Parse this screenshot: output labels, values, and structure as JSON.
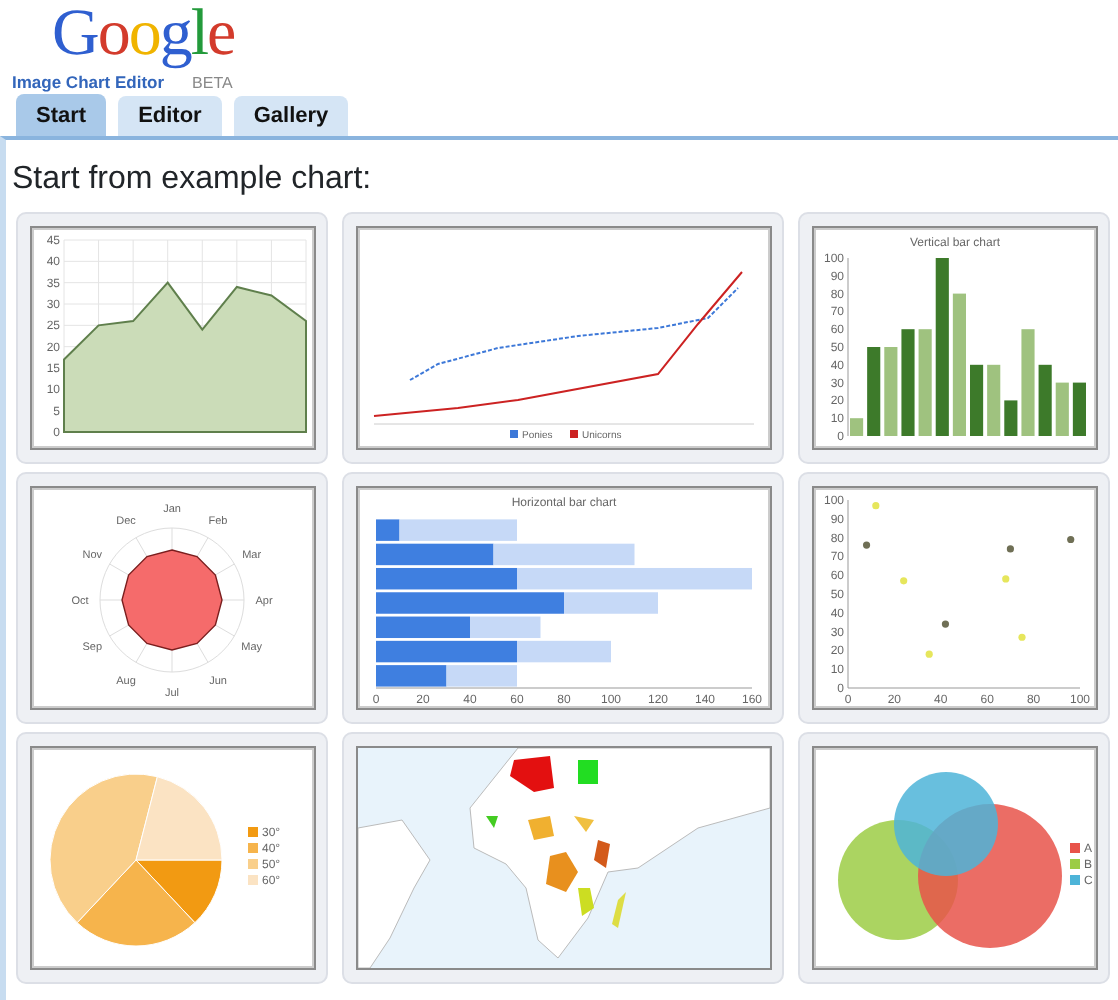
{
  "logo": {
    "wordmark": "Google",
    "product": "Image Chart Editor",
    "badge": "BETA"
  },
  "tabs": [
    {
      "label": "Start",
      "selected": true
    },
    {
      "label": "Editor",
      "selected": false
    },
    {
      "label": "Gallery",
      "selected": false
    }
  ],
  "heading": "Start from example chart:",
  "examples": [
    {
      "chart_data": {
        "type": "area",
        "grid": true,
        "ylim": [
          0,
          45
        ],
        "yticks": [
          0,
          5,
          10,
          15,
          20,
          25,
          30,
          35,
          40,
          45
        ],
        "series": [
          {
            "color": "#5f7f4c",
            "values": [
              17,
              25,
              26,
              35,
              24,
              34,
              32,
              26
            ]
          }
        ]
      }
    },
    {
      "kind": "line",
      "legend": [
        {
          "label": "Ponies",
          "color": "#3d78d8"
        },
        {
          "label": "Unicorns",
          "color": "#cc2222"
        }
      ]
    },
    {
      "chart_data": {
        "type": "bar",
        "title": "Vertical bar chart",
        "categories": [
          null,
          null,
          null,
          null,
          null,
          null,
          null,
          null,
          null,
          null,
          null,
          null,
          null,
          null
        ],
        "ylim": [
          0,
          100
        ],
        "yticks": [
          0,
          10,
          20,
          30,
          40,
          50,
          60,
          70,
          80,
          90,
          100
        ],
        "series": [
          {
            "colors": [
              "#9fc27f",
              "#3d7a2a",
              "#9fc27f",
              "#3d7a2a",
              "#9fc27f",
              "#3d7a2a",
              "#9fc27f",
              "#3d7a2a",
              "#9fc27f",
              "#3d7a2a",
              "#9fc27f",
              "#3d7a2a",
              "#9fc27f",
              "#3d7a2a"
            ],
            "values": [
              10,
              50,
              50,
              60,
              60,
              100,
              80,
              40,
              40,
              20,
              60,
              40,
              30,
              30
            ]
          }
        ]
      }
    },
    {
      "kind": "radar",
      "labels": [
        "Jan",
        "Feb",
        "Mar",
        "Apr",
        "May",
        "Jun",
        "Jul",
        "Aug",
        "Sep",
        "Oct",
        "Nov",
        "Dec"
      ]
    },
    {
      "chart_data": {
        "type": "bar",
        "orientation": "horizontal",
        "stacked": true,
        "title": "Horizontal bar chart",
        "categories": [
          null,
          null,
          null,
          null,
          null,
          null,
          null
        ],
        "xlim": [
          0,
          160
        ],
        "xticks": [
          0,
          20,
          40,
          60,
          80,
          100,
          120,
          140,
          160
        ],
        "series": [
          {
            "color": "#3f7fe0",
            "values": [
              10,
              50,
              60,
              80,
              40,
              60,
              30
            ]
          },
          {
            "color": "#c6d9f7",
            "values": [
              50,
              60,
              100,
              40,
              30,
              40,
              30
            ]
          }
        ]
      }
    },
    {
      "chart_data": {
        "type": "scatter",
        "xlim": [
          0,
          100
        ],
        "ylim": [
          0,
          100
        ],
        "xticks": [
          0,
          20,
          40,
          60,
          80,
          100
        ],
        "yticks": [
          0,
          10,
          20,
          30,
          40,
          50,
          60,
          70,
          80,
          90,
          100
        ],
        "series": [
          {
            "color": "#e6e65c",
            "x": [
              12,
              24,
              35,
              68,
              75
            ],
            "values": [
              97,
              57,
              18,
              58,
              27
            ]
          },
          {
            "color": "#6f6f55",
            "x": [
              8,
              42,
              70,
              96
            ],
            "values": [
              76,
              34,
              74,
              79
            ]
          }
        ]
      }
    },
    {
      "kind": "pie",
      "legend": [
        {
          "label": "30°",
          "color": "#f29a12"
        },
        {
          "label": "40°",
          "color": "#f6b44c"
        },
        {
          "label": "50°",
          "color": "#f9cf8b"
        },
        {
          "label": "60°",
          "color": "#fbe3c3"
        }
      ]
    },
    {
      "kind": "picture"
    },
    {
      "kind": "venn",
      "legend": [
        {
          "label": "A",
          "color": "#e8534a"
        },
        {
          "label": "B",
          "color": "#9ccc45"
        },
        {
          "label": "C",
          "color": "#4db4d8"
        }
      ]
    }
  ]
}
